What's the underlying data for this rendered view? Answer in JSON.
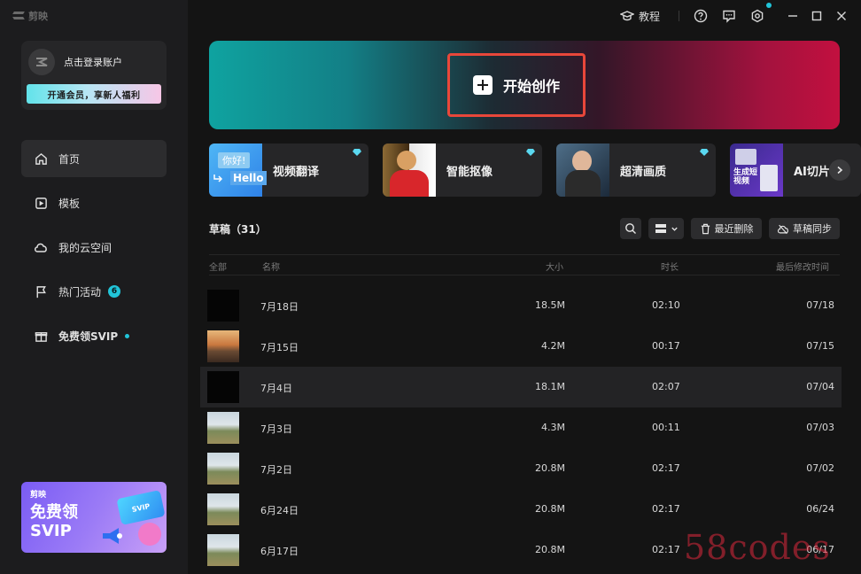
{
  "app": {
    "logo_text": "剪映"
  },
  "account": {
    "login_text": "点击登录账户",
    "vip_banner": "开通会员，享新人福利"
  },
  "nav": [
    {
      "label": "首页",
      "icon": "home-icon",
      "active": true
    },
    {
      "label": "模板",
      "icon": "template-icon"
    },
    {
      "label": "我的云空间",
      "icon": "cloud-icon"
    },
    {
      "label": "热门活动",
      "icon": "flag-icon",
      "badge": "6"
    },
    {
      "label": "免费领SVIP",
      "icon": "gift-icon",
      "dot": true
    }
  ],
  "promo": {
    "brand": "剪映",
    "title": "免费领SVIP",
    "card_text": "SVIP"
  },
  "titlebar": {
    "tutorial": "教程"
  },
  "hero": {
    "create_label": "开始创作"
  },
  "features": [
    {
      "label": "视频翻译",
      "thumb_text_top": "你好!",
      "thumb_text_bottom": "Hello"
    },
    {
      "label": "智能抠像"
    },
    {
      "label": "超清画质"
    },
    {
      "label": "AI切片",
      "thumb_text": "生成短视频"
    }
  ],
  "drafts": {
    "title": "草稿（31）",
    "recent_deleted": "最近删除",
    "sync": "草稿同步",
    "columns": {
      "all": "全部",
      "name": "名称",
      "size": "大小",
      "duration": "时长",
      "modified": "最后修改时间"
    },
    "rows": [
      {
        "name": "7月18日",
        "size": "18.5M",
        "duration": "02:10",
        "modified": "07/18",
        "thumb": "black"
      },
      {
        "name": "7月15日",
        "size": "4.2M",
        "duration": "00:17",
        "modified": "07/15",
        "thumb": "sunset"
      },
      {
        "name": "7月4日",
        "size": "18.1M",
        "duration": "02:07",
        "modified": "07/04",
        "thumb": "black",
        "selected": true
      },
      {
        "name": "7月3日",
        "size": "4.3M",
        "duration": "00:11",
        "modified": "07/03",
        "thumb": "landscape"
      },
      {
        "name": "7月2日",
        "size": "20.8M",
        "duration": "02:17",
        "modified": "07/02",
        "thumb": "landscape"
      },
      {
        "name": "6月24日",
        "size": "20.8M",
        "duration": "02:17",
        "modified": "06/24",
        "thumb": "landscape"
      },
      {
        "name": "6月17日",
        "size": "20.8M",
        "duration": "02:17",
        "modified": "06/17",
        "thumb": "landscape"
      }
    ]
  },
  "watermark": "58codes",
  "colors": {
    "accent": "#21c4d8",
    "highlight_border": "#e8473a",
    "background": "#141414",
    "sidebar": "#1c1c1e"
  }
}
